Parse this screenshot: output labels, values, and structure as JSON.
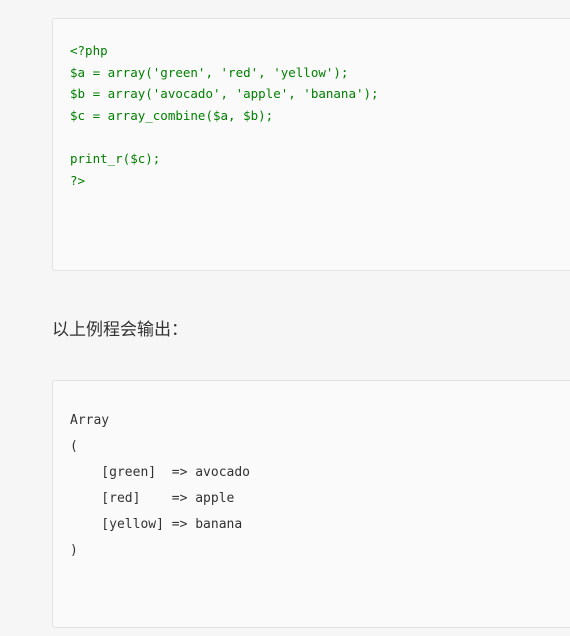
{
  "code_block": {
    "lines": [
      "<?php",
      "$a = array('green', 'red', 'yellow');",
      "$b = array('avocado', 'apple', 'banana');",
      "$c = array_combine($a, $b);",
      "",
      "print_r($c);",
      "?>"
    ]
  },
  "caption": "以上例程会输出：",
  "output_block": {
    "lines": [
      "Array",
      "(",
      "    [green]  => avocado",
      "    [red]    => apple",
      "    [yellow] => banana",
      ")"
    ]
  },
  "colors": {
    "code_text": "#008000",
    "output_text": "#333333",
    "panel_background": "#fafafa",
    "page_background": "#f6f6f6"
  }
}
